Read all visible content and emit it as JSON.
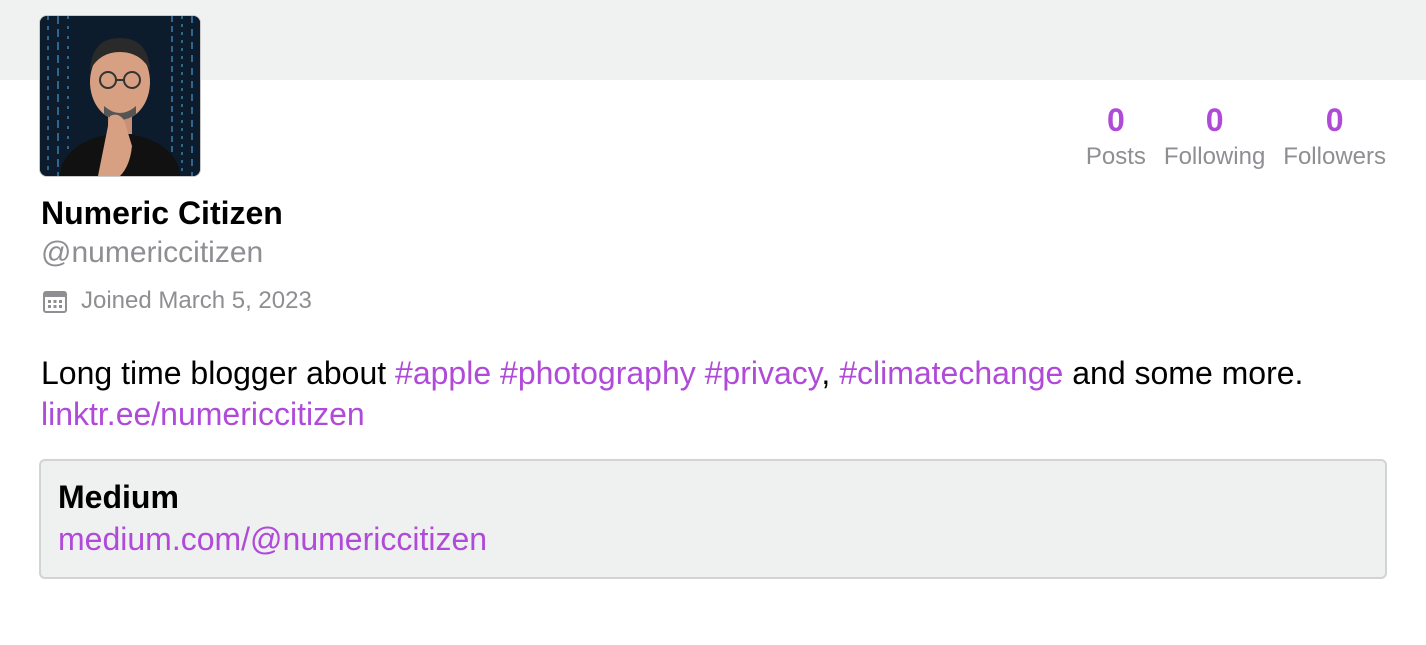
{
  "theme": {
    "accent": "#b04ad8",
    "muted": "#8e8e93"
  },
  "profile": {
    "avatar_icon": "user-avatar",
    "display_name": "Numeric Citizen",
    "handle": "@numericcitizen",
    "joined": "Joined March 5, 2023"
  },
  "stats": [
    {
      "count": "0",
      "label": "Posts"
    },
    {
      "count": "0",
      "label": "Following"
    },
    {
      "count": "0",
      "label": "Followers"
    }
  ],
  "bio": {
    "intro": "Long time blogger about ",
    "tag_apple": "#apple",
    "tag_photography": "#photography",
    "tag_privacy": "#privacy",
    "comma": ",",
    "tag_climatechange": "#climatechange",
    "middle": " and some more. ",
    "link": "linktr.ee/numericcitizen"
  },
  "fields": [
    {
      "name": "Medium",
      "value": "medium.com/@numericcitizen"
    }
  ]
}
